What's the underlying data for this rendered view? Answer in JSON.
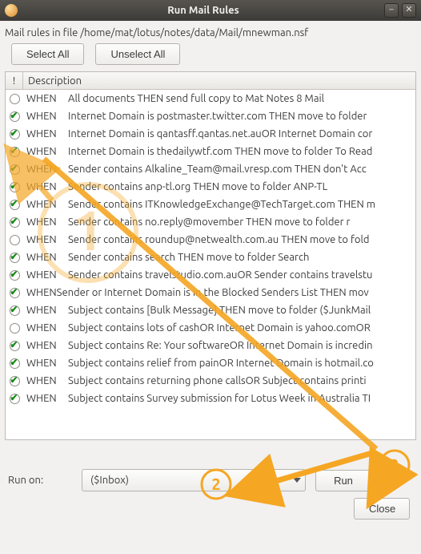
{
  "window": {
    "title": "Run Mail Rules"
  },
  "pathline": "Mail rules in file /home/mat/lotus/notes/data/Mail/mnewman.nsf",
  "buttons": {
    "select_all": "Select All",
    "unselect_all": "Unselect All",
    "run": "Run",
    "close": "Close"
  },
  "columns": {
    "bang": "!",
    "description": "Description"
  },
  "run_on": {
    "label": "Run on:",
    "selected": "($Inbox)"
  },
  "rules": [
    {
      "checked": false,
      "text": "All documents THEN  send full copy to Mat Notes 8 Mail"
    },
    {
      "checked": true,
      "text": "Internet Domain is postmaster.twitter.com THEN  move to folder"
    },
    {
      "checked": true,
      "text": "Internet Domain is qantasff.qantas.net.auOR Internet Domain cor"
    },
    {
      "checked": true,
      "text": "Internet Domain is thedailywtf.com THEN  move to folder To Read"
    },
    {
      "checked": true,
      "text": "Sender contains Alkaline_Team@mail.vresp.com THEN  don't Acc"
    },
    {
      "checked": true,
      "text": "Sender contains anp-tl.org THEN  move to folder ANP-TL"
    },
    {
      "checked": true,
      "text": "Sender contains ITKnowledgeExchange@TechTarget.com THEN  m"
    },
    {
      "checked": true,
      "text": "Sender contains no.reply@movember THEN  move to folder r"
    },
    {
      "checked": false,
      "text": "Sender contains roundup@netwealth.com.au THEN  move to fold"
    },
    {
      "checked": true,
      "text": "Sender contains search THEN  move to folder Search"
    },
    {
      "checked": true,
      "text": "Sender contains travelstudio.com.auOR Sender contains travelstu"
    },
    {
      "checked": true,
      "text": "WHENSender or Internet Domain is in the Blocked Senders List THEN mov",
      "nowhen": true
    },
    {
      "checked": true,
      "text": "Subject contains [Bulk Message] THEN  move to folder ($JunkMail"
    },
    {
      "checked": false,
      "text": "Subject contains lots of cashOR Internet Domain is yahoo.comOR"
    },
    {
      "checked": true,
      "text": "Subject contains Re: Your softwareOR Internet Domain is incredin"
    },
    {
      "checked": true,
      "text": "Subject contains relief from painOR Internet Domain is hotmail.co"
    },
    {
      "checked": true,
      "text": "Subject  contains returning phone callsOR Subject contains printi"
    },
    {
      "checked": true,
      "text": "Subject contains Survey submission for Lotus Week in Australia TI"
    }
  ],
  "annotations": {
    "step1": "1",
    "step2": "2",
    "step3": "3",
    "color": "#f5a623"
  }
}
